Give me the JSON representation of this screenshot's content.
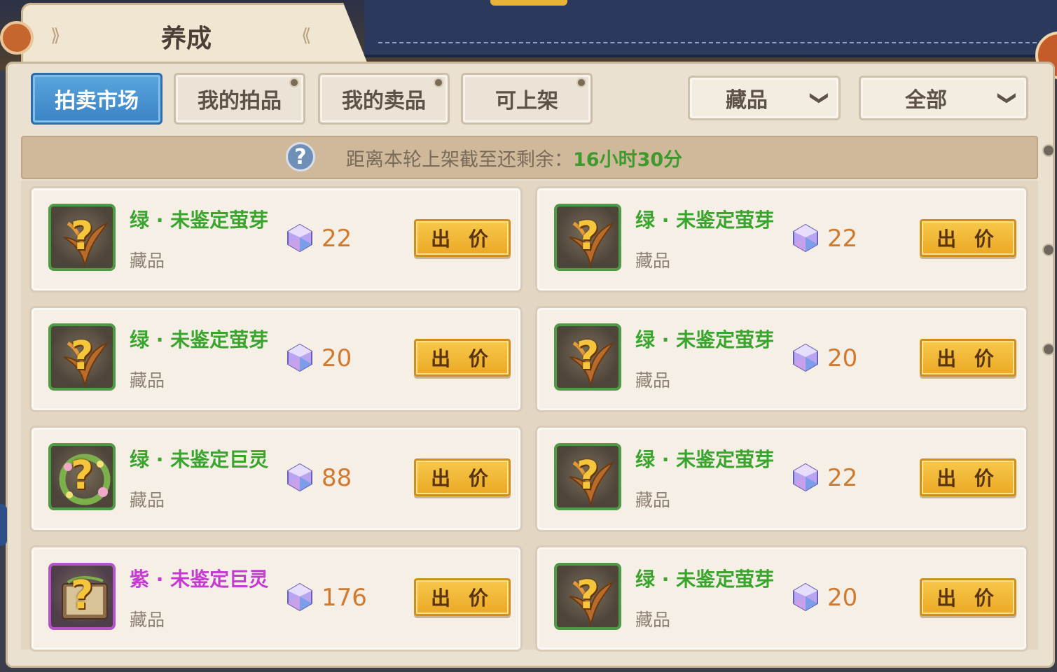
{
  "header": {
    "title": "养成"
  },
  "tabs": [
    {
      "label": "拍卖市场",
      "active": true
    },
    {
      "label": "我的拍品",
      "active": false
    },
    {
      "label": "我的卖品",
      "active": false
    },
    {
      "label": "可上架",
      "active": false
    }
  ],
  "filters": {
    "category": "藏品",
    "range": "全部"
  },
  "info": {
    "prefix": "距离本轮上架截至还剩余：",
    "time": "16小时30分",
    "help_icon": "question-icon"
  },
  "colors": {
    "accent_blue": "#3a82c4",
    "green_quality": "#3aa52c",
    "purple_quality": "#c43ad2",
    "price": "#d07a2f",
    "button": "#eba825",
    "info_time": "#3e9a2c"
  },
  "bid_label": "出 价",
  "items": [
    {
      "name": "绿 · 未鉴定萤芽",
      "type": "藏品",
      "price": "22",
      "quality": "green",
      "icon": "sprout-icon"
    },
    {
      "name": "绿 · 未鉴定萤芽",
      "type": "藏品",
      "price": "22",
      "quality": "green",
      "icon": "sprout-icon"
    },
    {
      "name": "绿 · 未鉴定萤芽",
      "type": "藏品",
      "price": "20",
      "quality": "green",
      "icon": "sprout-icon"
    },
    {
      "name": "绿 · 未鉴定萤芽",
      "type": "藏品",
      "price": "20",
      "quality": "green",
      "icon": "sprout-icon"
    },
    {
      "name": "绿 · 未鉴定巨灵",
      "type": "藏品",
      "price": "88",
      "quality": "green",
      "icon": "wreath-icon"
    },
    {
      "name": "绿 · 未鉴定萤芽",
      "type": "藏品",
      "price": "22",
      "quality": "green",
      "icon": "sprout-icon"
    },
    {
      "name": "紫 · 未鉴定巨灵",
      "type": "藏品",
      "price": "176",
      "quality": "purple",
      "icon": "book-icon"
    },
    {
      "name": "绿 · 未鉴定萤芽",
      "type": "藏品",
      "price": "20",
      "quality": "green",
      "icon": "sprout-icon"
    }
  ]
}
